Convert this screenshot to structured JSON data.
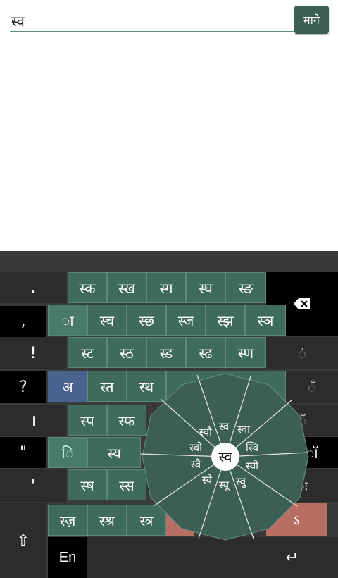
{
  "input": {
    "value": "स्व"
  },
  "go_label": "मागे",
  "left_keys": [
    ".",
    ",",
    "!",
    "?",
    "।",
    "\"",
    "'"
  ],
  "right_keys": [
    "ं",
    "ँ",
    "ॅ",
    "ॉ",
    "ः",
    "ऽ"
  ],
  "rows": {
    "r1": [
      "स्क",
      "स्ख",
      "स्ग",
      "स्घ",
      "स्ङ"
    ],
    "r2": [
      "ा",
      "स्च",
      "स्छ",
      "स्ज",
      "स्झ",
      "स्ञ"
    ],
    "r3": [
      "स्ट",
      "स्ठ",
      "स्ड",
      "स्ढ",
      "स्ण"
    ],
    "r4": [
      "अ",
      "स्त",
      "स्थ"
    ],
    "r5": [
      "स्प",
      "स्फ"
    ],
    "r6": [
      "ि",
      "स्य"
    ],
    "r7": [
      "स्ष",
      "स्स"
    ],
    "r8": [
      "स्ज़",
      "स्श्र",
      "स्त्र"
    ]
  },
  "radial": {
    "center": "स्व",
    "items": [
      "स्वा",
      "स्वि",
      "स्वी",
      "स्वु",
      "स्वू",
      "स्वे",
      "स्वै",
      "स्वो",
      "स्वौ",
      "स्व"
    ]
  },
  "bottom": {
    "shift": "⇧",
    "lang": "En",
    "enter": "↵"
  },
  "colors": {
    "key_green": "#3f6b5f",
    "accent_blue": "#4a6290",
    "salmon": "#b86f63"
  }
}
